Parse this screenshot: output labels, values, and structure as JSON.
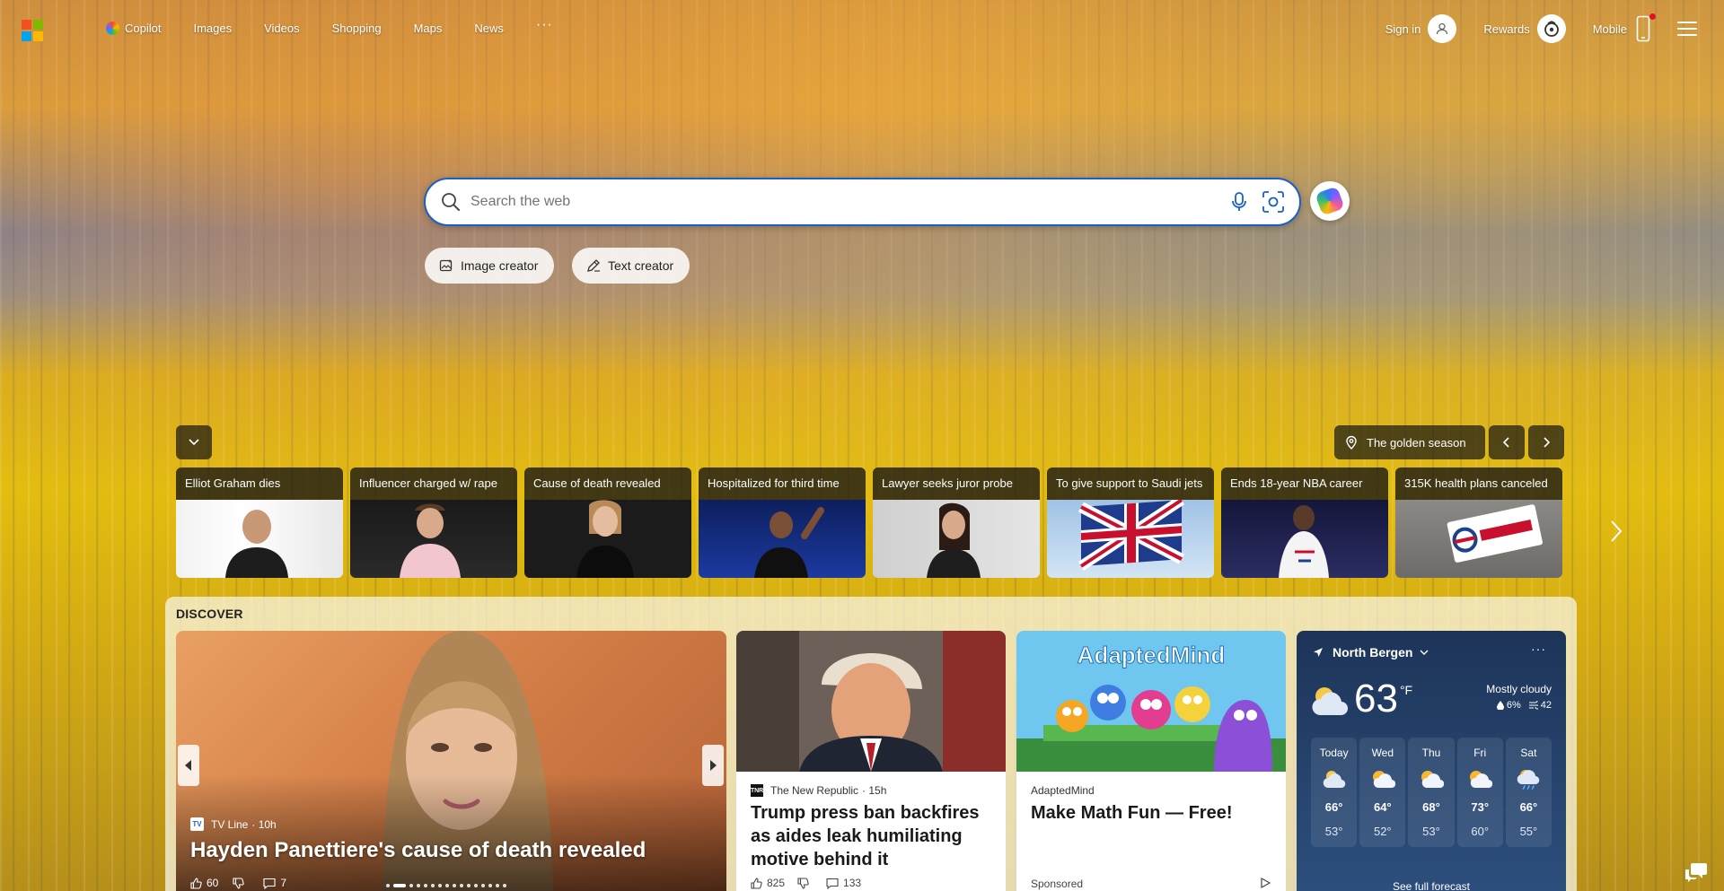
{
  "nav": {
    "items": [
      "Copilot",
      "Images",
      "Videos",
      "Shopping",
      "Maps",
      "News"
    ],
    "more": "···"
  },
  "top_right": {
    "sign_in": "Sign in",
    "rewards": "Rewards",
    "mobile": "Mobile"
  },
  "search": {
    "placeholder": "Search the web"
  },
  "chips": {
    "image_creator": "Image creator",
    "text_creator": "Text creator"
  },
  "trending": {
    "location_label": "The golden season",
    "items": [
      "Elliot Graham dies",
      "Influencer charged w/ rape",
      "Cause of death revealed",
      "Hospitalized for third time",
      "Lawyer seeks juror probe",
      "To give support to Saudi jets",
      "Ends 18-year NBA career",
      "315K health plans canceled"
    ]
  },
  "discover": {
    "label": "DISCOVER",
    "hero": {
      "source": "TV Line",
      "source_logo": "TV",
      "age": "· 10h",
      "title": "Hayden Panettiere's cause of death revealed",
      "likes": "60",
      "comments": "7"
    },
    "news": {
      "source": "The New Republic",
      "source_logo": "TNR",
      "age": "· 15h",
      "title": "Trump press ban backfires as aides leak humiliating motive behind it",
      "likes": "825",
      "comments": "133"
    },
    "ad": {
      "source": "AdaptedMind",
      "brand_text": "AdaptedMind",
      "title": "Make Math Fun — Free!",
      "sponsored": "Sponsored"
    }
  },
  "weather": {
    "location": "North Bergen",
    "more": "···",
    "temp": "63",
    "unit": "°F",
    "condition": "Mostly cloudy",
    "precip": "6%",
    "aqi": "42",
    "forecast": [
      {
        "day": "Today",
        "hi": "66°",
        "lo": "53°"
      },
      {
        "day": "Wed",
        "hi": "64°",
        "lo": "52°"
      },
      {
        "day": "Thu",
        "hi": "68°",
        "lo": "53°"
      },
      {
        "day": "Fri",
        "hi": "73°",
        "lo": "60°"
      },
      {
        "day": "Sat",
        "hi": "66°",
        "lo": "55°"
      }
    ],
    "link": "See full forecast"
  },
  "colors": {
    "ms_red": "#f25022",
    "ms_green": "#7fba00",
    "ms_blue": "#00a4ef",
    "ms_yellow": "#ffb900",
    "search_border": "#1a5fc6"
  }
}
